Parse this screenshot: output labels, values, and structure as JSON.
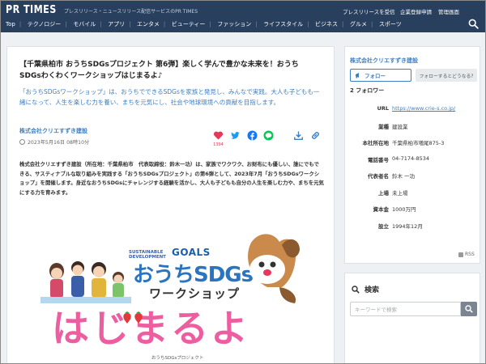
{
  "header": {
    "logo": "PR TIMES",
    "tagline": "プレスリリース・ニュースリリース配信サービスのPR TIMES",
    "links": [
      "プレスリリースを受信",
      "企業登録申請",
      "管理画面"
    ],
    "nav": [
      "Top",
      "テクノロジー",
      "モバイル",
      "アプリ",
      "エンタメ",
      "ビューティー",
      "ファッション",
      "ライフスタイル",
      "ビジネス",
      "グルメ",
      "スポーツ"
    ]
  },
  "article": {
    "title": "【千葉県柏市 おうちSDGsプロジェクト 第6弾】楽しく学んで豊かな未来を！おうちSDGsわくわくワークショップはじまるよ♪",
    "lead": "「おうちSDGsワークショップ」は、おうちでできるSDGsを家族と発見し、みんなで実践。大人も子どもも一緒になって、人生を楽しむ力を養い、まちを元気にし、社会や地球環境への貢献を目指します。",
    "company": "株式会社クリエすずき建設",
    "date": "2023年5月16日 08時10分",
    "like_count": "1394",
    "body": "株式会社クリエすずき建設（所在地：千葉県柏市　代表取締役：鈴木一功）は、家族でワクワク、お財布にも優しい、誰にでもできる、サスティナブルな取り組みを実践する「おうちSDGsプロジェクト」の第6弾として、2023年7月「おうちSDGsワークショップ」を開催します。身近なおうちSDGsにチャレンジする経験を活かし、大人も子どもも自分の人生を楽しむ力や、まちを元気にする力を育みます。"
  },
  "hero": {
    "sdg_line1": "SUSTAINABLE",
    "sdg_line2": "DEVELOPMENT",
    "goals": "GOALS",
    "title": "おうちSDGs",
    "subtitle": "ワークショップ",
    "big": "はじまるよ",
    "credit": "おうちSDGsプロジェクト"
  },
  "sidebar": {
    "company": "株式会社クリエすずき建設",
    "follow_label": "フォロー",
    "follow_question": "フォローするとどうなる?",
    "follow_count": "2 フォロワー",
    "info": [
      {
        "key": "URL",
        "value": "https://www.crie-s.co.jp/"
      },
      {
        "key": "業種",
        "value": "建設業"
      },
      {
        "key": "本社所在地",
        "value": "千葉県柏市増尾875-3"
      },
      {
        "key": "電話番号",
        "value": "04-7174-8534"
      },
      {
        "key": "代表者名",
        "value": "鈴木 一功"
      },
      {
        "key": "上場",
        "value": "未上場"
      },
      {
        "key": "資本金",
        "value": "1000万円"
      },
      {
        "key": "設立",
        "value": "1994年12月"
      }
    ],
    "rss": "RSS",
    "search_title": "検索",
    "search_placeholder": "キーワードで検索"
  },
  "colors": {
    "header_bg": "#283f5e",
    "accent": "#3d7fc4",
    "heart": "#e8375a",
    "twitter": "#1d9bf0",
    "facebook": "#1877f2",
    "line": "#06c755",
    "hero_pink": "#ed5ea0"
  }
}
